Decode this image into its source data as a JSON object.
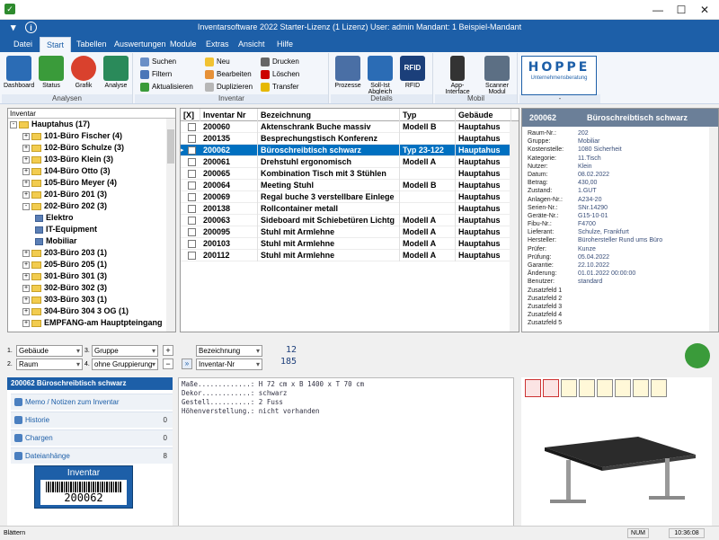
{
  "window": {
    "title": "Inventarsoftware 2022 Starter-Lizenz (1 Lizenz)   User: admin   Mandant: 1 Beispiel-Mandant"
  },
  "ribbon_tabs": [
    "Datei",
    "Start",
    "Tabellen",
    "Auswertungen",
    "Module",
    "Extras",
    "Ansicht",
    "Hilfe"
  ],
  "ribbon": {
    "analysen": {
      "label": "Analysen",
      "buttons": [
        "Dashboard",
        "Status",
        "Grafik",
        "Analyse"
      ]
    },
    "inventar": {
      "label": "Inventar",
      "col1": [
        "Suchen",
        "Filtern",
        "Aktualisieren"
      ],
      "col2": [
        "Neu",
        "Bearbeiten",
        "Duplizieren"
      ],
      "col3": [
        "Drucken",
        "Löschen",
        "Transfer"
      ]
    },
    "details": {
      "label": "Details",
      "buttons": [
        "Prozesse",
        "Soll-Ist Abgleich",
        "RFID"
      ]
    },
    "mobil": {
      "label": "Mobil",
      "buttons": [
        "App-Interface",
        "Scanner Modul"
      ]
    },
    "brand": {
      "label": "-",
      "name": "HOPPE",
      "sub": "Unternehmensberatung"
    }
  },
  "tree": {
    "header": "Inventar",
    "root": "Hauptahus  (17)",
    "items": [
      {
        "label": "101-Büro Fischer  (4)",
        "indent": 1,
        "type": "folder",
        "pm": "+"
      },
      {
        "label": "102-Büro  Schulze  (3)",
        "indent": 1,
        "type": "folder",
        "pm": "+"
      },
      {
        "label": "103-Büro Klein  (3)",
        "indent": 1,
        "type": "folder",
        "pm": "+"
      },
      {
        "label": "104-Büro  Otto  (3)",
        "indent": 1,
        "type": "folder",
        "pm": "+"
      },
      {
        "label": "105-Büro  Meyer  (4)",
        "indent": 1,
        "type": "folder",
        "pm": "+"
      },
      {
        "label": "201-Büro 201  (3)",
        "indent": 1,
        "type": "folder",
        "pm": "+"
      },
      {
        "label": "202-Büro 202  (3)",
        "indent": 1,
        "type": "folder",
        "pm": "-"
      },
      {
        "label": "Elektro",
        "indent": 2,
        "type": "leaf",
        "pm": ""
      },
      {
        "label": "IT-Equipment",
        "indent": 2,
        "type": "leaf",
        "pm": ""
      },
      {
        "label": "Mobiliar",
        "indent": 2,
        "type": "leaf",
        "pm": ""
      },
      {
        "label": "203-Büro 203  (1)",
        "indent": 1,
        "type": "folder",
        "pm": "+"
      },
      {
        "label": "205-Büro 205  (1)",
        "indent": 1,
        "type": "folder",
        "pm": "+"
      },
      {
        "label": "301-Büro 301  (3)",
        "indent": 1,
        "type": "folder",
        "pm": "+"
      },
      {
        "label": "302-Büro 302  (3)",
        "indent": 1,
        "type": "folder",
        "pm": "+"
      },
      {
        "label": "303-Büro 303  (1)",
        "indent": 1,
        "type": "folder",
        "pm": "+"
      },
      {
        "label": "304-Büro 304  3 OG  (1)",
        "indent": 1,
        "type": "folder",
        "pm": "+"
      },
      {
        "label": "EMPFANG-am Hauptpteingang",
        "indent": 1,
        "type": "folder",
        "pm": "+"
      }
    ]
  },
  "grid": {
    "columns": [
      "[X]",
      "Inventar Nr",
      "Bezeichnung",
      "Typ",
      "Gebäude"
    ],
    "rows": [
      {
        "nr": "200060",
        "bez": "Aktenschrank Buche massiv",
        "typ": "Modell B",
        "geb": "Hauptahus",
        "sel": false
      },
      {
        "nr": "200135",
        "bez": "Besprechungstisch Konferenz",
        "typ": "",
        "geb": "Hauptahus",
        "sel": false
      },
      {
        "nr": "200062",
        "bez": "Büroschreibtisch  schwarz",
        "typ": "Typ 23-122",
        "geb": "Hauptahus",
        "sel": true
      },
      {
        "nr": "200061",
        "bez": "Drehstuhl ergonomisch",
        "typ": "Modell A",
        "geb": "Hauptahus",
        "sel": false
      },
      {
        "nr": "200065",
        "bez": "Kombination Tisch mit 3 Stühlen",
        "typ": "",
        "geb": "Hauptahus",
        "sel": false
      },
      {
        "nr": "200064",
        "bez": "Meeting Stuhl",
        "typ": "Modell B",
        "geb": "Hauptahus",
        "sel": false
      },
      {
        "nr": "200069",
        "bez": "Regal buche  3 verstellbare Einlege",
        "typ": "",
        "geb": "Hauptahus",
        "sel": false
      },
      {
        "nr": "200138",
        "bez": "Rollcontainer metall",
        "typ": "",
        "geb": "Hauptahus",
        "sel": false
      },
      {
        "nr": "200063",
        "bez": "Sideboard mit Schiebetüren Lichtg",
        "typ": "Modell A",
        "geb": "Hauptahus",
        "sel": false
      },
      {
        "nr": "200095",
        "bez": "Stuhl mit Armlehne",
        "typ": "Modell A",
        "geb": "Hauptahus",
        "sel": false
      },
      {
        "nr": "200103",
        "bez": "Stuhl mit Armlehne",
        "typ": "Modell A",
        "geb": "Hauptahus",
        "sel": false
      },
      {
        "nr": "200112",
        "bez": "Stuhl mit Armlehne",
        "typ": "Modell A",
        "geb": "Hauptahus",
        "sel": false
      }
    ]
  },
  "detail": {
    "id": "200062",
    "title": "Büroschreibtisch  schwarz",
    "fields": [
      [
        "Raum-Nr.:",
        "202"
      ],
      [
        "Gruppe:",
        "Mobiliar"
      ],
      [
        "Kostenstelle:",
        "1080 Sicherheit"
      ],
      [
        "Kategorie:",
        "11.Tisch"
      ],
      [
        "Nutzer:",
        "Klein"
      ],
      [
        "Datum:",
        "08.02.2022"
      ],
      [
        "Betrag:",
        "430,00"
      ],
      [
        "Zustand:",
        "1.GUT"
      ],
      [
        "Anlagen-Nr.:",
        "A234-20"
      ],
      [
        "Serien-Nr.:",
        "SNr.14290"
      ],
      [
        "Geräte-Nr.:",
        "G15-10-01"
      ],
      [
        "Fibu-Nr.:",
        "F4700"
      ],
      [
        "Lieferant:",
        "Schulze, Frankfurt"
      ],
      [
        "Hersteller:",
        "Bürohersteller Rund ums Büro"
      ],
      [
        "Prüfer:",
        "Kunze"
      ],
      [
        "Prüfung:",
        "05.04.2022"
      ],
      [
        "Garantie:",
        "22.10.2022"
      ],
      [
        "Änderung:",
        "01.01.2022 00:00:00"
      ],
      [
        "Benutzer:",
        "standard"
      ],
      [
        "Zusatzfeld 1",
        ""
      ],
      [
        "Zusatzfeld 2",
        ""
      ],
      [
        "Zusatzfeld 3",
        ""
      ],
      [
        "Zusatzfeld 4",
        ""
      ],
      [
        "Zusatzfeld 5",
        ""
      ]
    ]
  },
  "groupbar": {
    "n1": "1.",
    "c1": "Gebäude",
    "n2": "2.",
    "c2": "Raum",
    "n3": "3.",
    "c3": "Gruppe",
    "n4": "4.",
    "c4": "ohne Gruppierung",
    "sort1": "Bezeichnung",
    "sort2": "Inventar-Nr",
    "count1": "12",
    "count2": "185"
  },
  "leftpanel": {
    "title": "200062  Büroschreibtisch  schwarz",
    "items": [
      {
        "label": "Memo / Notizen zum Inventar",
        "count": ""
      },
      {
        "label": "Historie",
        "count": "0"
      },
      {
        "label": "Chargen",
        "count": "0"
      },
      {
        "label": "Dateianhänge",
        "count": "8"
      }
    ],
    "barcode_label": "Inventar",
    "barcode_num": "200062"
  },
  "memo": [
    "Maße.............: H 72 cm x B 1400 x T 70 cm",
    "Dekor............: schwarz",
    "Gestell..........: 2 Fuss",
    "Höhenverstellung.: nicht vorhanden"
  ],
  "statusbar": {
    "left": "Blättern",
    "num": "NUM",
    "time": "10:36:08"
  },
  "colors": {
    "ribbon_blue": "#1d5fa8",
    "selection": "#0070c0",
    "detail_header": "#6b7f98"
  }
}
